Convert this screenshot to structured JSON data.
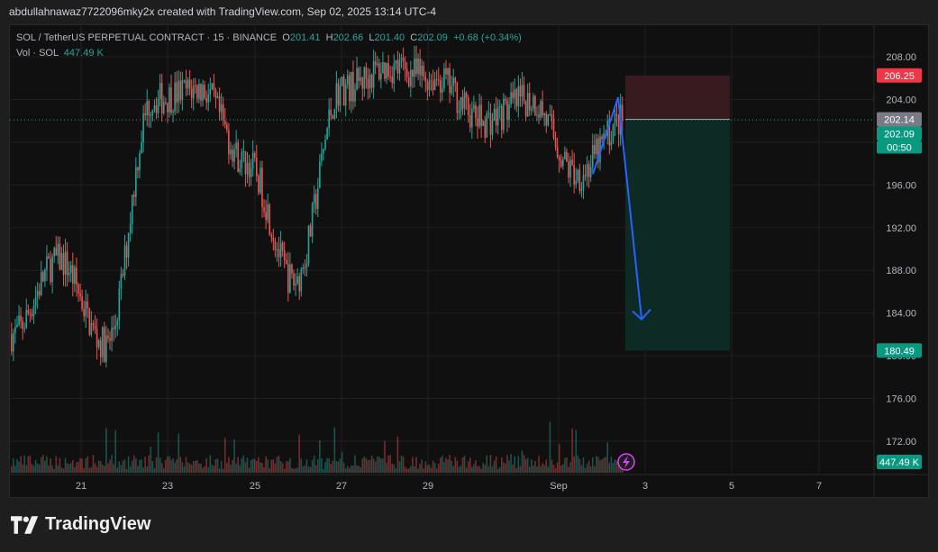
{
  "header": {
    "attribution": "abdullahnawaz7722096mky2x created with TradingView.com, Sep 02, 2025 13:14 UTC-4"
  },
  "legend": {
    "symbol": "SOL / TetherUS PERPETUAL CONTRACT · 15 · BINANCE",
    "o_label": "O",
    "o_value": "201.41",
    "h_label": "H",
    "h_value": "202.66",
    "l_label": "L",
    "l_value": "201.40",
    "c_label": "C",
    "c_value": "202.09",
    "change": "+0.68 (+0.34%)",
    "vol_label": "Vol · SOL",
    "vol_value": "447.49 K"
  },
  "brand": {
    "name": "TradingView"
  },
  "colors": {
    "up": "#26a69a",
    "down": "#ef5350",
    "stop_zone": "#3d1a1e",
    "target_zone": "#0f2e29",
    "arrow": "#2962ff",
    "grid": "#1f1f1f"
  },
  "chart_data": {
    "type": "candlestick",
    "x_ticks": [
      "21",
      "23",
      "25",
      "27",
      "29",
      "Sep",
      "3",
      "5",
      "7"
    ],
    "y_ticks": [
      208,
      204,
      200,
      196,
      192,
      188,
      184,
      180,
      176,
      172
    ],
    "ylim": [
      169,
      211
    ],
    "price_series_approx": [
      {
        "date": "Aug 20",
        "close": 182
      },
      {
        "date": "Aug 21",
        "close": 189
      },
      {
        "date": "Aug 22",
        "close": 181
      },
      {
        "date": "Aug 23",
        "close": 204
      },
      {
        "date": "Aug 24",
        "close": 205
      },
      {
        "date": "Aug 25",
        "close": 198
      },
      {
        "date": "Aug 26",
        "close": 187
      },
      {
        "date": "Aug 27",
        "close": 205
      },
      {
        "date": "Aug 28",
        "close": 207
      },
      {
        "date": "Aug 29",
        "close": 206
      },
      {
        "date": "Aug 30",
        "close": 202
      },
      {
        "date": "Aug 31",
        "close": 204
      },
      {
        "date": "Sep 01",
        "close": 197
      },
      {
        "date": "Sep 02",
        "close": 202.09
      }
    ],
    "position": {
      "side": "short",
      "entry": 202.14,
      "stop": 206.25,
      "target": 180.49
    },
    "price_labels": [
      {
        "text": "206.25",
        "kind": "stop"
      },
      {
        "text": "202.14",
        "kind": "entry"
      },
      {
        "text": "202.09",
        "kind": "last"
      },
      {
        "text": "00:50",
        "kind": "countdown"
      },
      {
        "text": "180.49",
        "kind": "target"
      },
      {
        "text": "447.49 K",
        "kind": "volume"
      }
    ]
  }
}
